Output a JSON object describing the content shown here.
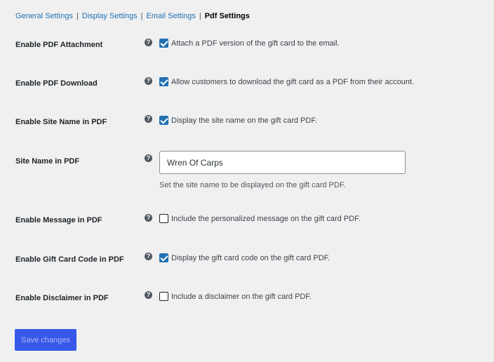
{
  "subnav": {
    "tabs": [
      {
        "label": "General Settings"
      },
      {
        "label": "Display Settings"
      },
      {
        "label": "Email Settings"
      },
      {
        "label": "Pdf Settings"
      }
    ],
    "separator": "|"
  },
  "help_glyph": "?",
  "fields": {
    "pdf_attachment": {
      "label": "Enable PDF Attachment",
      "checked": true,
      "text": "Attach a PDF version of the gift card to the email."
    },
    "pdf_download": {
      "label": "Enable PDF Download",
      "checked": true,
      "text": "Allow customers to download the gift card as a PDF from their account."
    },
    "site_name_enable": {
      "label": "Enable Site Name in PDF",
      "checked": true,
      "text": "Display the site name on the gift card PDF."
    },
    "site_name": {
      "label": "Site Name in PDF",
      "value": "Wren Of Carps",
      "description": "Set the site name to be displayed on the gift card PDF."
    },
    "message": {
      "label": "Enable Message in PDF",
      "checked": false,
      "text": "Include the personalized message on the gift card PDF."
    },
    "gift_code": {
      "label": "Enable Gift Card Code in PDF",
      "checked": true,
      "text": "Display the gift card code on the gift card PDF."
    },
    "disclaimer": {
      "label": "Enable Disclaimer in PDF",
      "checked": false,
      "text": "Include a disclaimer on the gift card PDF."
    }
  },
  "save_button": {
    "label": "Save changes"
  },
  "colors": {
    "background": "#f0f0f1",
    "link": "#2271b1",
    "checkbox_checked": "#2271b1",
    "primary_button": "#3858e9"
  }
}
